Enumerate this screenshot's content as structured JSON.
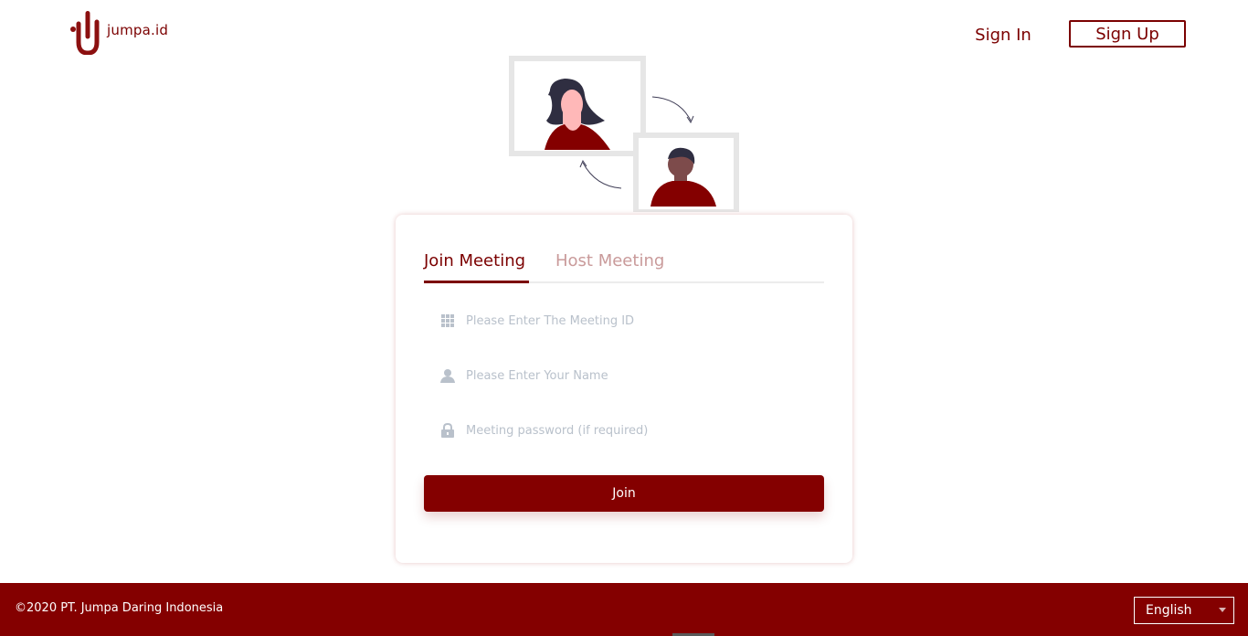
{
  "header": {
    "logo_text": "jumpa.id",
    "sign_in": "Sign In",
    "sign_up": "Sign Up"
  },
  "card": {
    "tabs": [
      {
        "label": "Join Meeting",
        "active": true
      },
      {
        "label": "Host Meeting",
        "active": false
      }
    ],
    "fields": {
      "meeting_id_placeholder": "Please Enter The Meeting ID",
      "name_placeholder": "Please Enter Your Name",
      "password_placeholder": "Meeting password (if required)"
    },
    "join_label": "Join"
  },
  "footer": {
    "copyright": "©2020 PT. Jumpa Daring Indonesia",
    "language": "English"
  },
  "colors": {
    "brand": "#840000",
    "brand_text": "#7b0000",
    "tab_inactive": "#c99a9a",
    "placeholder": "#b9c1cb"
  },
  "icons": {
    "meeting_id": "grid-icon",
    "name": "user-icon",
    "password": "lock-icon"
  }
}
